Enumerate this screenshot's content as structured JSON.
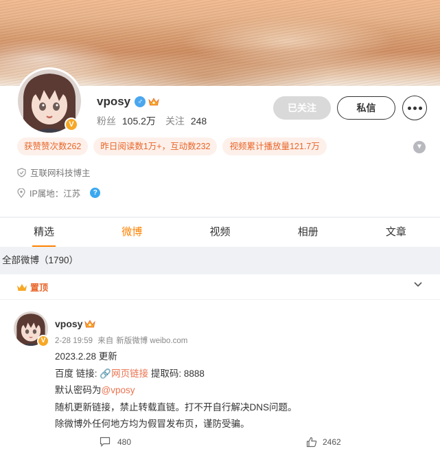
{
  "profile": {
    "username": "vposy",
    "fans_label": "粉丝",
    "fans_value": "105.2万",
    "following_label": "关注",
    "following_value": "248",
    "followed_button": "已关注",
    "message_button": "私信",
    "tags": [
      "获赞赞次数262",
      "昨日阅读数1万+，互动数232",
      "视频累计播放量121.7万"
    ],
    "info_category": "互联网科技博主",
    "info_ip": "IP属地：江苏"
  },
  "tabs": [
    "精选",
    "微博",
    "视频",
    "相册",
    "文章"
  ],
  "count_bar": "全部微博（1790）",
  "post": {
    "pin_label": "置顶",
    "author": "vposy",
    "time": "2-28 19:59",
    "source_prefix": "来自",
    "source": "新版微博 weibo.com",
    "line1": "2023.2.28 更新",
    "line2_pre": "百度  链接: ",
    "line2_link": "网页链接",
    "line2_post": " 提取码: 8888",
    "line3_pre": "默认密码为",
    "line3_mention": "@vposy",
    "line4": "随机更新链接，禁止转载直链。打不开自行解决DNS问题。",
    "line5": "除微博外任何地方均为假冒发布页，谨防受骗。",
    "comments": "480",
    "likes": "2462"
  },
  "colors": {
    "accent": "#ff8200",
    "tag_text": "#e8662a",
    "tag_bg": "#fdf0ea",
    "link": "#eb7350"
  }
}
